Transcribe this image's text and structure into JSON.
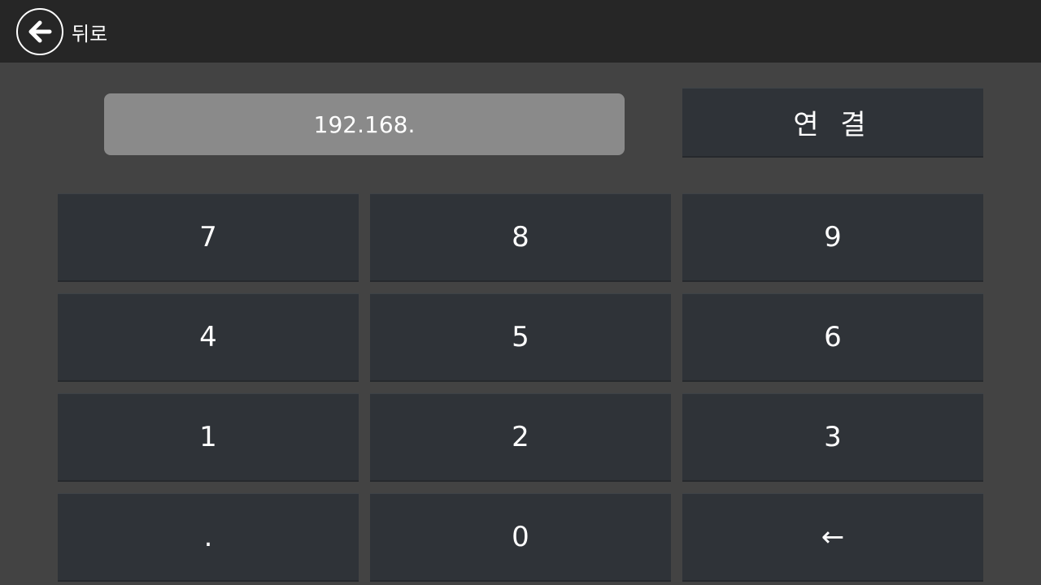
{
  "header": {
    "back_label": "뒤로",
    "back_icon": "arrow-left-circle-icon"
  },
  "ip_input": {
    "value": "192.168."
  },
  "connect_button": {
    "label": "연 결"
  },
  "keypad": {
    "keys": [
      "7",
      "8",
      "9",
      "4",
      "5",
      "6",
      "1",
      "2",
      "3",
      ".",
      "0",
      "←"
    ]
  },
  "colors": {
    "background": "#434343",
    "topbar": "#262626",
    "button": "#2f3338",
    "input": "#8a8a8a",
    "text": "#ffffff"
  }
}
